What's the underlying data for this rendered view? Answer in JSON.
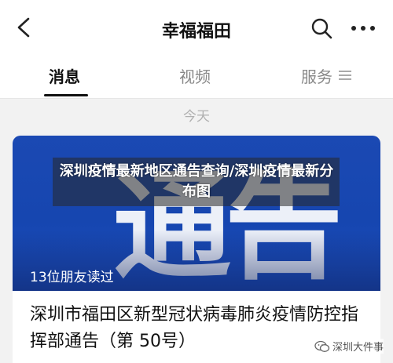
{
  "header": {
    "title": "幸福福田"
  },
  "tabs": [
    {
      "label": "消息",
      "active": true
    },
    {
      "label": "视频",
      "active": false
    },
    {
      "label": "服务",
      "active": false
    }
  ],
  "feed": {
    "date_label": "今天",
    "card": {
      "banner_text": "通告",
      "friends_read": "13位朋友读过",
      "title": "深圳市福田区新型冠状病毒肺炎疫情防控指挥部通告（第 50号）"
    }
  },
  "overlay": {
    "caption": "深圳疫情最新地区通告查询/深圳疫情最新分布图"
  },
  "watermark": {
    "text": "深圳大件事"
  },
  "colors": {
    "banner_blue": "#1b49b3",
    "active_tab": "#111111",
    "inactive_tab": "#888888"
  },
  "icons": [
    "back-arrow-icon",
    "search-icon",
    "more-dots-icon",
    "menu-lines-icon",
    "wechat-icon"
  ]
}
